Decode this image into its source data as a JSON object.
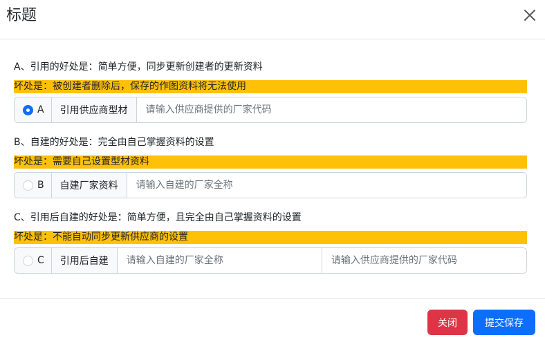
{
  "dialog": {
    "title": "标题"
  },
  "options": [
    {
      "good": "A、引用的好处是：简单方便，同步更新创建者的更新资料",
      "bad": "坏处是：被创建者删除后，保存的作图资料将无法使用",
      "letter": "A",
      "checked": true,
      "label": "引用供应商型材",
      "placeholders": [
        "请输入供应商提供的厂家代码"
      ]
    },
    {
      "good": "B、自建的好处是：完全由自己掌握资料的设置",
      "bad": "坏处是：需要自己设置型材资料",
      "letter": "B",
      "checked": false,
      "label": "自建厂家资料",
      "placeholders": [
        "请输入自建的厂家全称"
      ]
    },
    {
      "good": "C、引用后自建的好处是：简单方便，且完全由自己掌握资料的设置",
      "bad": "坏处是：不能自动同步更新供应商的设置",
      "letter": "C",
      "checked": false,
      "label": "引用后自建",
      "placeholders": [
        "请输入自建的厂家全称",
        "请输入供应商提供的厂家代码"
      ]
    }
  ],
  "footer": {
    "close_label": "关闭",
    "save_label": "提交保存"
  },
  "colors": {
    "warning_bg": "#ffc107",
    "primary": "#0d6efd",
    "danger": "#dc3545"
  },
  "icons": {
    "close": "close-icon"
  }
}
